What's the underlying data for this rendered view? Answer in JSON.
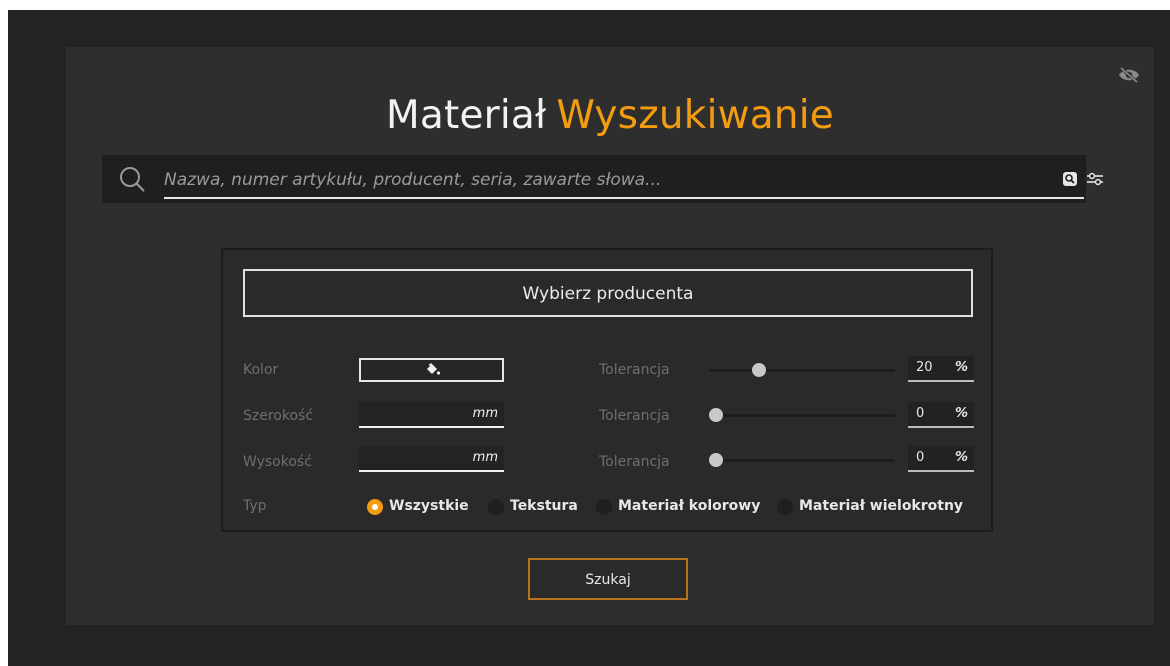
{
  "header": {
    "title_main": "Materiał",
    "title_accent": "Wyszukiwanie",
    "visibility_icon": "eye-off-icon"
  },
  "search": {
    "placeholder": "Nazwa, numer artykułu, producent, seria, zawarte słowa...",
    "value": "",
    "icons": [
      "search-icon",
      "image-search-icon",
      "filter-settings-icon"
    ]
  },
  "filters": {
    "producer_button": "Wybierz producenta",
    "color_label": "Kolor",
    "color_icon": "paint-bucket-icon",
    "width_label": "Szerokość",
    "width_unit": "mm",
    "height_label": "Wysokość",
    "height_unit": "mm",
    "tolerances": [
      {
        "label": "Tolerancja",
        "value": "20",
        "unit": "%",
        "level_percent": 25
      },
      {
        "label": "Tolerancja",
        "value": "0",
        "unit": "%",
        "level_percent": 0
      },
      {
        "label": "Tolerancja",
        "value": "0",
        "unit": "%",
        "level_percent": 0
      }
    ],
    "type_label": "Typ",
    "type_options": [
      "Wszystkie",
      "Tekstura",
      "Materiał kolorowy",
      "Materiał wielokrotny"
    ],
    "type_selected": "Wszystkie"
  },
  "actions": {
    "search_button": "Szukaj"
  },
  "colors": {
    "accent": "#f39c12",
    "button_border": "#b8741a",
    "panel": "#2e2e2e",
    "background": "#232323"
  }
}
